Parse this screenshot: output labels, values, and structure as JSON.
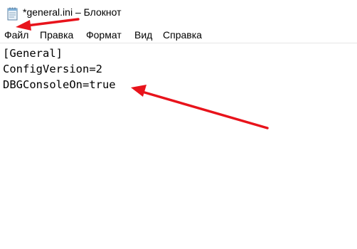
{
  "window": {
    "title": "*general.ini – Блокнот"
  },
  "menu": {
    "items": [
      "Файл",
      "Правка",
      "Формат",
      "Вид",
      "Справка"
    ]
  },
  "editor": {
    "lines": [
      "[General]",
      "ConfigVersion=2",
      "DBGConsoleOn=true"
    ]
  },
  "annotations": {
    "arrow_color": "#e8131b"
  },
  "icons": {
    "app": "notepad-icon"
  }
}
